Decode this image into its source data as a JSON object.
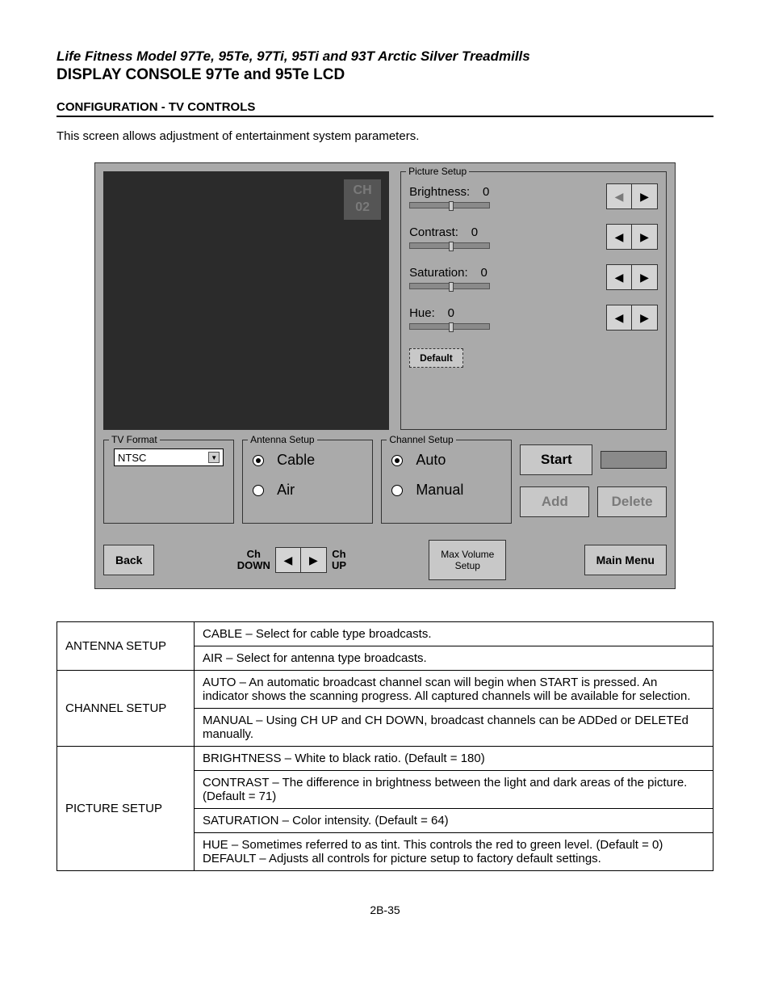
{
  "header": {
    "model_line": "Life Fitness Model 97Te, 95Te, 97Ti, 95Ti and 93T Arctic Silver Treadmills",
    "title": "DISPLAY CONSOLE 97Te and 95Te LCD",
    "section": "CONFIGURATION - TV CONTROLS",
    "intro": "This screen allows adjustment of entertainment system parameters."
  },
  "screenshot": {
    "ch_badge_line1": "CH",
    "ch_badge_line2": "02",
    "picture_setup": {
      "legend": "Picture Setup",
      "brightness": {
        "label": "Brightness:",
        "value": "0"
      },
      "contrast": {
        "label": "Contrast:",
        "value": "0"
      },
      "saturation": {
        "label": "Saturation:",
        "value": "0"
      },
      "hue": {
        "label": "Hue:",
        "value": "0"
      },
      "default_btn": "Default"
    },
    "tv_format": {
      "legend": "TV Format",
      "selected": "NTSC"
    },
    "antenna": {
      "legend": "Antenna Setup",
      "opt1": "Cable",
      "opt2": "Air"
    },
    "channel": {
      "legend": "Channel Setup",
      "opt1": "Auto",
      "opt2": "Manual"
    },
    "actions": {
      "start": "Start",
      "add": "Add",
      "delete": "Delete"
    },
    "bottom": {
      "back": "Back",
      "ch_down": "Ch\nDOWN",
      "ch_up": "Ch\nUP",
      "max_vol": "Max Volume\nSetup",
      "main_menu": "Main Menu"
    }
  },
  "table": {
    "rows": [
      {
        "head": "ANTENNA SETUP",
        "cells": [
          "CABLE – Select for cable type broadcasts.",
          "AIR – Select for antenna type broadcasts."
        ]
      },
      {
        "head": "CHANNEL SETUP",
        "cells": [
          "AUTO – An automatic broadcast channel scan will begin when START is pressed. An indicator shows the scanning progress. All captured channels will be available for selection.",
          "MANUAL – Using CH UP and CH DOWN, broadcast channels can be ADDed or DELETEd manually."
        ]
      },
      {
        "head": "PICTURE SETUP",
        "cells": [
          "BRIGHTNESS – White to black ratio. (Default = 180)",
          "CONTRAST – The difference in brightness between the light and dark areas of the picture.(Default = 71)",
          "SATURATION – Color intensity. (Default = 64)",
          "HUE – Sometimes referred to as tint. This controls the red to green level. (Default = 0) DEFAULT – Adjusts all controls for picture setup to factory default settings."
        ]
      }
    ]
  },
  "page_number": "2B-35"
}
